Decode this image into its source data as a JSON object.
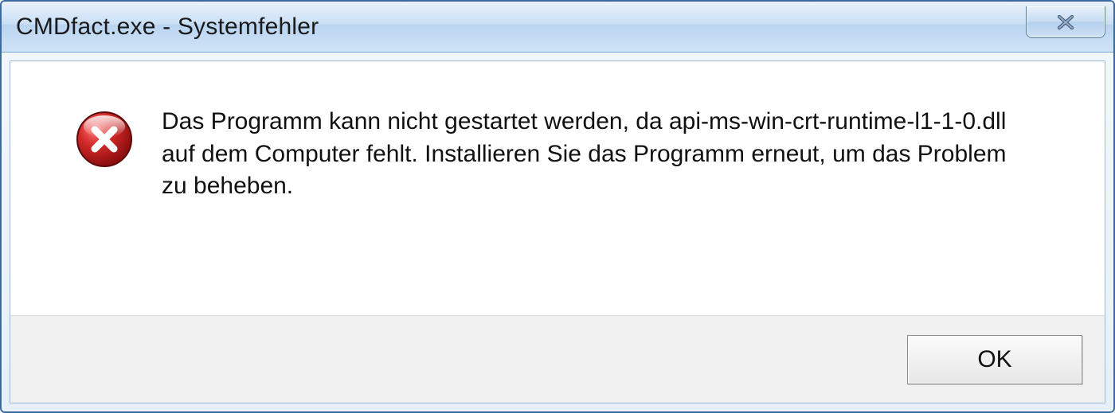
{
  "titlebar": {
    "title": "CMDfact.exe - Systemfehler"
  },
  "icon": {
    "name": "error-icon"
  },
  "message": {
    "text": "Das Programm kann nicht gestartet werden, da api-ms-win-crt-runtime-l1-1-0.dll auf dem Computer fehlt. Installieren Sie das Programm erneut, um das Problem zu beheben."
  },
  "buttons": {
    "ok_label": "OK"
  }
}
